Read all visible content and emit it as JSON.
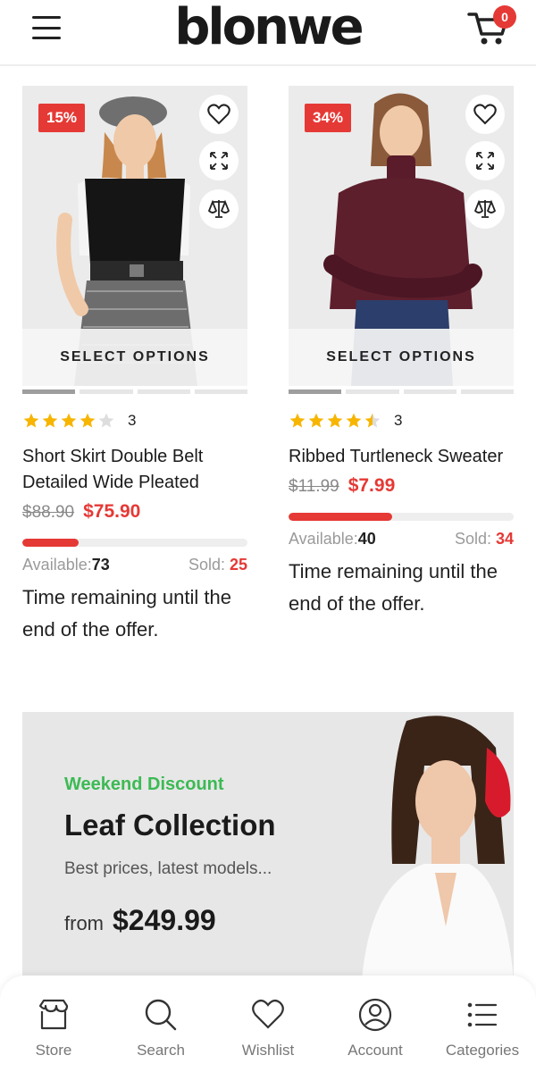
{
  "header": {
    "logo": "blonwe",
    "cart_count": "0",
    "icons": [
      "menu-icon",
      "cart-icon"
    ]
  },
  "products": [
    {
      "discount": "15%",
      "select_label": "SELECT OPTIONS",
      "rating": 4,
      "rating_count": "3",
      "name": "Short Skirt Double Belt Detailed Wide Pleated",
      "old_price": "$88.90",
      "price": "$75.90",
      "sold_fraction": 0.25,
      "available_label": "Available:",
      "available": "73",
      "sold_label": "Sold: ",
      "sold": "25",
      "timer_text": "Time remaining until the end of the offer."
    },
    {
      "discount": "34%",
      "select_label": "SELECT OPTIONS",
      "rating": 4.5,
      "rating_count": "3",
      "name": "Ribbed Turtleneck Sweater",
      "old_price": "$11.99",
      "price": "$7.99",
      "sold_fraction": 0.46,
      "available_label": "Available:",
      "available": "40",
      "sold_label": "Sold: ",
      "sold": "34",
      "timer_text": "Time remaining until the end of the offer."
    }
  ],
  "banner": {
    "tag": "Weekend Discount",
    "title": "Leaf Collection",
    "subtitle": "Best prices, latest models...",
    "from_label": "from",
    "price": "$249.99"
  },
  "bottom_nav": [
    {
      "label": "Store",
      "icon": "store-icon"
    },
    {
      "label": "Search",
      "icon": "search-icon"
    },
    {
      "label": "Wishlist",
      "icon": "heart-icon"
    },
    {
      "label": "Account",
      "icon": "account-icon"
    },
    {
      "label": "Categories",
      "icon": "categories-icon"
    }
  ],
  "colors": {
    "accent": "#e53935",
    "success": "#3cba54",
    "star": "#f7b500"
  }
}
